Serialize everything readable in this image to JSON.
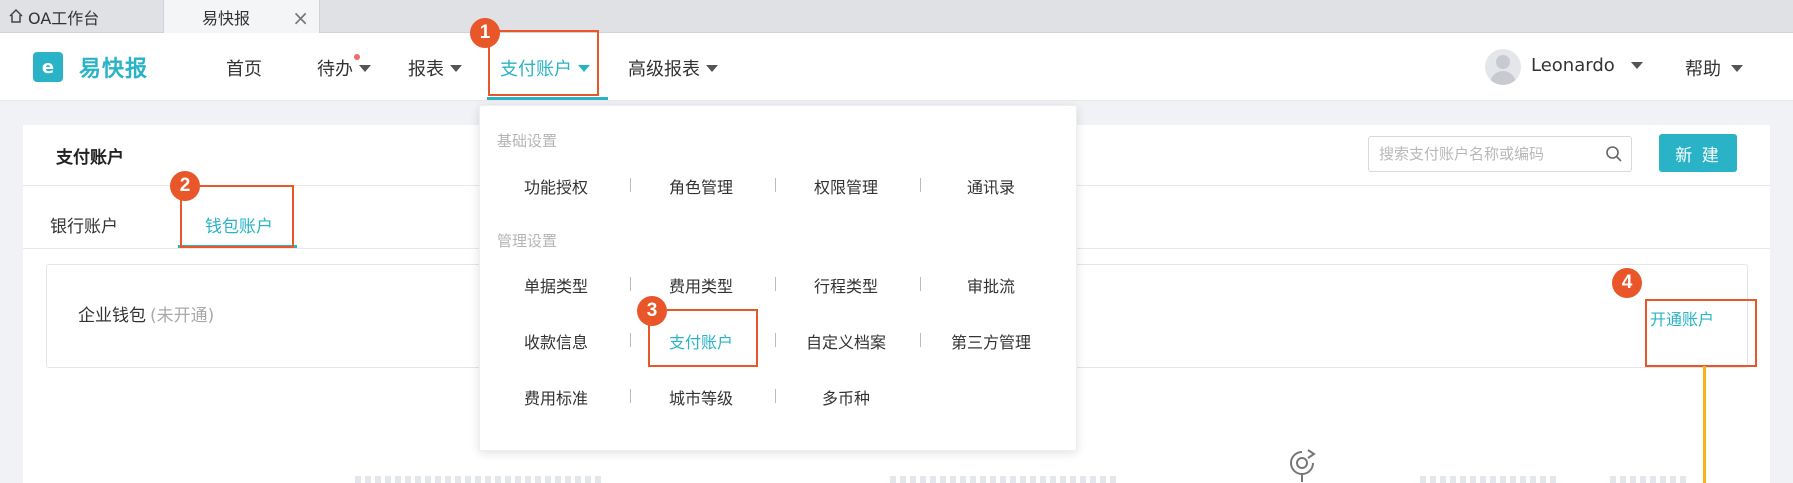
{
  "browser_tabs": [
    {
      "label": "OA工作台"
    },
    {
      "label": "易快报"
    }
  ],
  "app": {
    "logo_glyph": "e",
    "name": "易快报"
  },
  "nav": {
    "items": [
      {
        "label": "首页"
      },
      {
        "label": "待办"
      },
      {
        "label": "报表"
      },
      {
        "label": "支付账户"
      },
      {
        "label": "高级报表"
      }
    ],
    "user": "Leonardo",
    "help": "帮助"
  },
  "page": {
    "title": "支付账户",
    "search_placeholder": "搜索支付账户名称或编码",
    "new_button": "新 建",
    "subtabs": [
      {
        "label": "银行账户"
      },
      {
        "label": "钱包账户"
      }
    ],
    "wallet": {
      "label": "企业钱包",
      "status": "(未开通)",
      "action": "开通账户"
    }
  },
  "dropdown": {
    "sections": [
      {
        "title": "基础设置",
        "rows": [
          [
            "功能授权",
            "角色管理",
            "权限管理",
            "通讯录"
          ]
        ]
      },
      {
        "title": "管理设置",
        "rows": [
          [
            "单据类型",
            "费用类型",
            "行程类型",
            "审批流"
          ],
          [
            "收款信息",
            "支付账户",
            "自定义档案",
            "第三方管理"
          ],
          [
            "费用标准",
            "城市等级",
            "多币种"
          ]
        ]
      }
    ],
    "selected": "支付账户"
  },
  "annotations": [
    {
      "number": "1"
    },
    {
      "number": "2"
    },
    {
      "number": "3"
    },
    {
      "number": "4"
    }
  ],
  "colors": {
    "accent": "#2ab3c6",
    "annotation": "#e8562a",
    "annotation_line": "#f5b21a",
    "badge": "#f06a6a"
  }
}
